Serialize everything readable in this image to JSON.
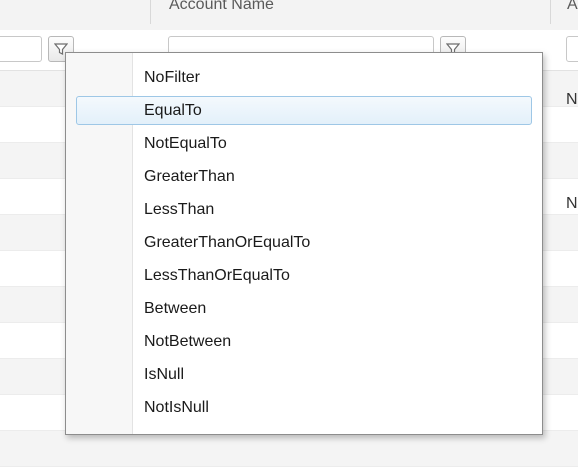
{
  "header": {
    "columns": [
      {
        "label": ""
      },
      {
        "label": "Account Name"
      },
      {
        "label": "A"
      }
    ]
  },
  "rows": [
    {
      "fragment": ""
    },
    {
      "fragment": "N"
    },
    {
      "fragment": ""
    },
    {
      "fragment": ""
    },
    {
      "fragment": "N"
    },
    {
      "fragment": ""
    },
    {
      "fragment": ""
    },
    {
      "fragment": ""
    },
    {
      "fragment": ""
    },
    {
      "fragment": ""
    },
    {
      "fragment": ""
    }
  ],
  "filter_menu": {
    "hovered_index": 1,
    "items": [
      "NoFilter",
      "EqualTo",
      "NotEqualTo",
      "GreaterThan",
      "LessThan",
      "GreaterThanOrEqualTo",
      "LessThanOrEqualTo",
      "Between",
      "NotBetween",
      "IsNull",
      "NotIsNull"
    ]
  },
  "icons": {
    "filter_button_1": "funnel-icon",
    "filter_button_2": "funnel-icon"
  },
  "colors": {
    "hover_border": "#9ec7e6",
    "hover_fill": "#e3f0fa"
  }
}
